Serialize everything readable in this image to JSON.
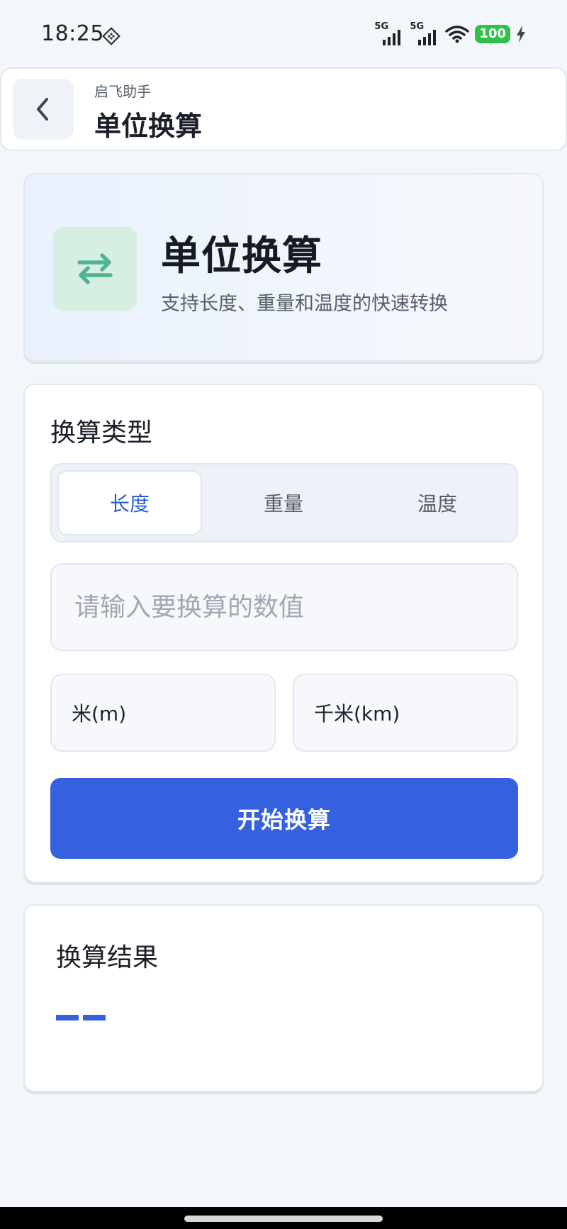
{
  "status_bar": {
    "time": "18:25",
    "network_1": "5G",
    "network_2": "5G",
    "battery": "100"
  },
  "header": {
    "app_name": "启飞助手",
    "title": "单位换算"
  },
  "hero": {
    "title": "单位换算",
    "description": "支持长度、重量和温度的快速转换",
    "icon": "swap-arrows-icon"
  },
  "converter": {
    "section_title": "换算类型",
    "tabs": [
      {
        "label": "长度",
        "active": true
      },
      {
        "label": "重量",
        "active": false
      },
      {
        "label": "温度",
        "active": false
      }
    ],
    "input": {
      "value": "",
      "placeholder": "请输入要换算的数值"
    },
    "from_unit": "米(m)",
    "to_unit": "千米(km)",
    "submit_label": "开始换算"
  },
  "result": {
    "title": "换算结果",
    "value": "——"
  },
  "colors": {
    "accent": "#3561e0",
    "active_tab_text": "#2a5bd0",
    "icon_green": "#4fb494",
    "battery_green": "#2fc14a"
  }
}
